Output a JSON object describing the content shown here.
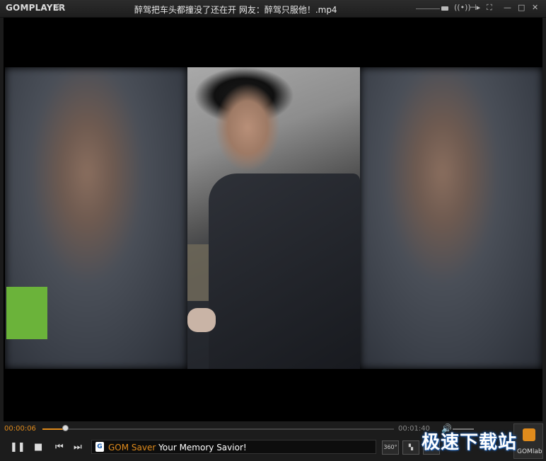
{
  "app": {
    "logo": "GOMPLAYER",
    "title": "醉驾把车头都撞没了还在开   网友：醉驾只服他！.mp4"
  },
  "window_controls": {
    "settings_icon": "gear-icon",
    "speaker_icon": "speaker-icon",
    "skip_icon": "skip-icon",
    "minimize": "—",
    "maximize": "□",
    "close": "✕"
  },
  "player": {
    "current_time": "00:00:06",
    "total_time": "00:01:40",
    "progress_fraction": 0.065,
    "volume_fraction": 0.9
  },
  "controls": {
    "play_pause": "❚❚",
    "stop": "■",
    "prev": "⏮",
    "next": "⏭",
    "btn_360": "360°"
  },
  "banner": {
    "brand": "GOM Saver",
    "tagline": "Your Memory Savior!"
  },
  "gomlab": {
    "label": "GOMlab"
  },
  "watermark": {
    "text": "极速下载站"
  },
  "colors": {
    "accent": "#e08b1c",
    "green_box": "#6bb33a"
  }
}
